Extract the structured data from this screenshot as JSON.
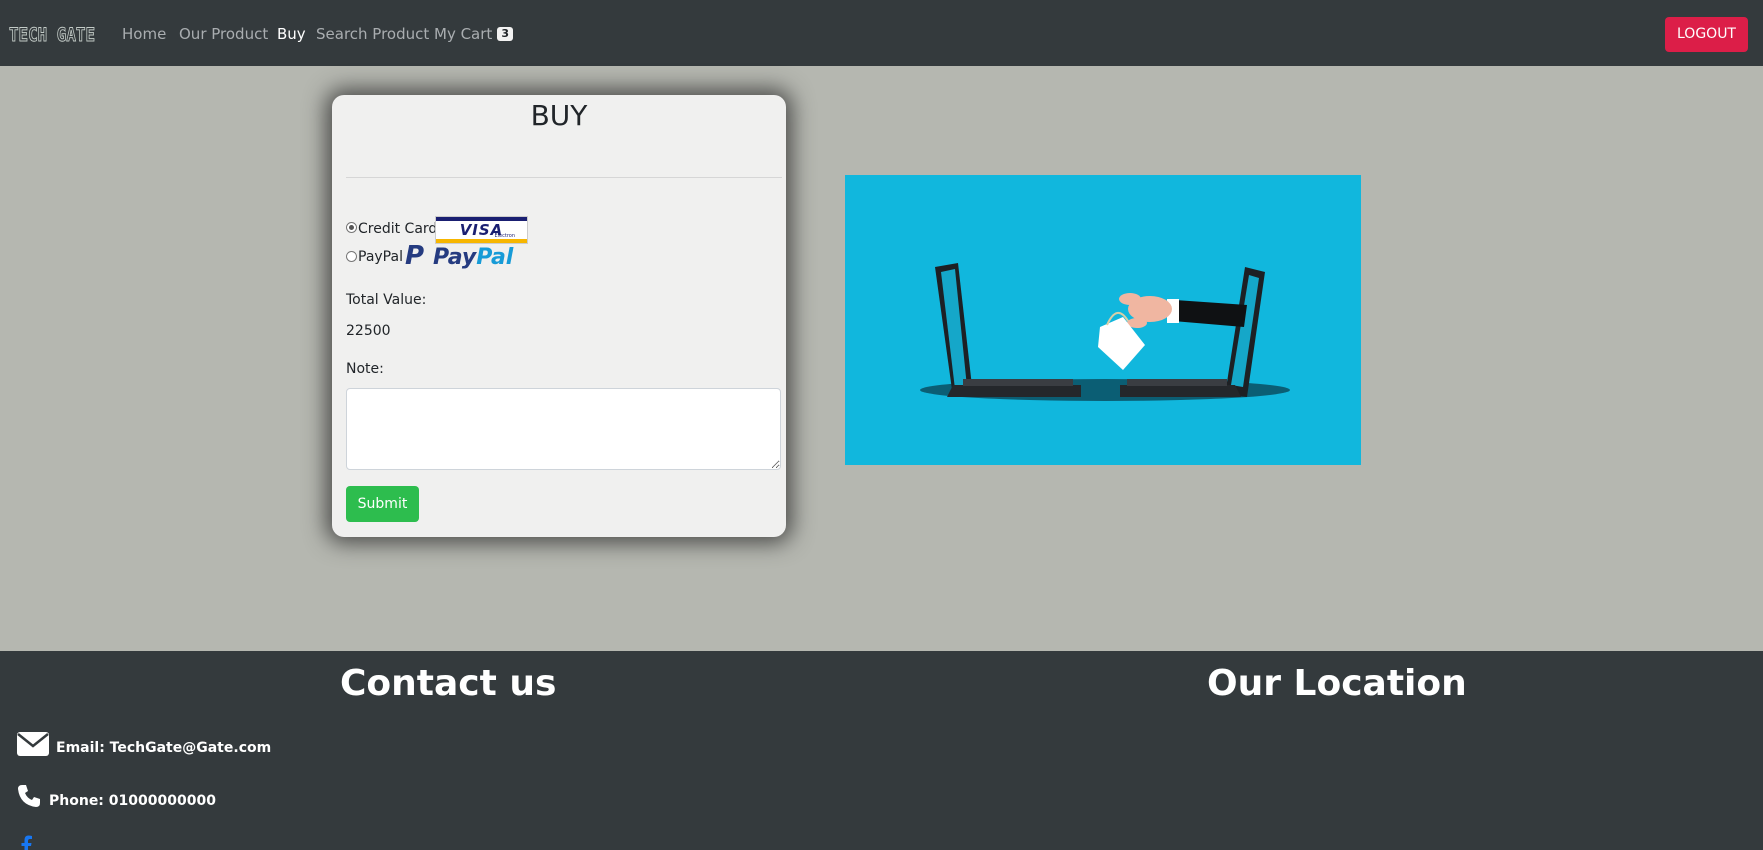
{
  "navbar": {
    "brand": "TECH GATE",
    "links": [
      {
        "label": "Home"
      },
      {
        "label": "Our Product"
      },
      {
        "label": "Buy"
      },
      {
        "label": "Search Product"
      },
      {
        "label": "My Cart"
      }
    ],
    "cart_count": "3",
    "logout_label": "LOGOUT"
  },
  "buy_form": {
    "title": "BUY",
    "payment_options": [
      {
        "label": "Credit Card",
        "checked": true,
        "logo": "VISA",
        "logo_subtext": "Electron"
      },
      {
        "label": "PayPal",
        "checked": false,
        "logo": "PayPal"
      }
    ],
    "total_label": "Total Value:",
    "total_value": "22500",
    "note_label": "Note:",
    "note_value": "",
    "submit_label": "Submit"
  },
  "illustration": {
    "icon": "online-shopping-laptops-hand-bag-icon"
  },
  "footer": {
    "contact_heading": "Contact us",
    "location_heading": "Our Location",
    "email": "Email: TechGate@Gate.com",
    "phone": "Phone: 01000000000",
    "icons": [
      "envelope-icon",
      "phone-icon",
      "facebook-icon"
    ]
  },
  "colors": {
    "navbar_bg": "#343a3d",
    "page_bg": "#b5b7b0",
    "logout": "#dc1e48",
    "submit": "#2dbd4e",
    "illustration_bg": "#11b7dd",
    "paypal_dark": "#253b80",
    "paypal_light": "#179bd7"
  }
}
